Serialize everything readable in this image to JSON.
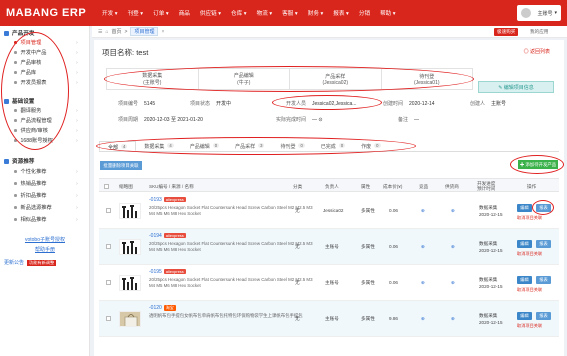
{
  "app": {
    "logo": "MABANG ERP",
    "user": "主账号"
  },
  "nav": [
    "开发 ▾",
    "刊登 ▾",
    "订单 ▾",
    "商品",
    "供应链 ▾",
    "仓库 ▾",
    "物流 ▾",
    "客服 ▾",
    "财务 ▾",
    "报表 ▾",
    "分销",
    "帮助 ▾"
  ],
  "sidebar": {
    "groups": [
      {
        "label": "产品开发",
        "items": [
          "项目管理",
          "开发中产品",
          "产品审核",
          "产品库",
          "开发员报表"
        ]
      },
      {
        "label": "基础设置",
        "items": [
          "翻译服务",
          "产品流程管理",
          "供应商/审核",
          "1688账号授权"
        ]
      },
      {
        "label": "资源推荐",
        "items": [
          "个性化推荐",
          "热销品推荐",
          "折扣品推荐",
          "新品选源推荐",
          "相似品推荐"
        ]
      }
    ],
    "links": [
      "votobo子账号授权",
      "帮助手册"
    ],
    "notice": "更新公告",
    "notice_badge": "功能有新调整"
  },
  "breadcrumb": {
    "home": "首页",
    "sep": ">",
    "current": "项目管理"
  },
  "top_buttons": {
    "red": "极速购买",
    "link": "我的应用"
  },
  "project": {
    "title_label": "项目名称:",
    "title": "test",
    "back": "◎ 返回列表",
    "steps": [
      {
        "name": "数据采集",
        "sub": "(主账号)"
      },
      {
        "name": "产品编辑",
        "sub": "(牛子)"
      },
      {
        "name": "产品采样",
        "sub": "(Jessica02)"
      },
      {
        "name": "待刊登",
        "sub": "(Jessica01)"
      }
    ],
    "edit_button": "✎ 编辑项目信息",
    "info": {
      "code_label": "项目编号",
      "code": "5145",
      "status_label": "项目状态",
      "status": "开发中",
      "dev_label": "开发人员",
      "dev": "Jessica02,Jessica...",
      "created_label": "创建时间",
      "created": "2020-12-14",
      "creator_label": "创建人",
      "creator": "主账号",
      "period_label": "项目周期",
      "period": "2020-12-03 至 2021-01-20",
      "actual_label": "实际完成时间",
      "actual": "— ⊙",
      "note_label": "备注",
      "note": "—"
    }
  },
  "tabs": [
    {
      "label": "全部",
      "count": "4"
    },
    {
      "label": "数据采集",
      "count": "4"
    },
    {
      "label": "产品编辑",
      "count": "0"
    },
    {
      "label": "产品采样",
      "count": "3"
    },
    {
      "label": "待刊登",
      "count": "0"
    },
    {
      "label": "已完成",
      "count": "0"
    },
    {
      "label": "作废",
      "count": "0"
    }
  ],
  "batch_button": "批量删除项目关联",
  "add_button": "✚ 添加待开发产品",
  "columns": [
    "",
    "缩略图",
    "SKU编号 / 来源 / 名称",
    "分类",
    "负责人",
    "属性",
    "成本价(¥)",
    "竞品",
    "供货商",
    "开发进度\n预计时间",
    "操作"
  ],
  "rows": [
    {
      "sku": "-0193",
      "badge": "aliexpress",
      "title": "20/25pcs Hexagon Socket Flat Countersunk Head Screw Carbon Steel M2 M2.5 M3 M4 M5 M6 M8 Hex Socket",
      "category": "无",
      "owner": "Jessica02",
      "attr": "多属性",
      "cost": "0.06",
      "stage": "数据采集",
      "date": "2020-12-15",
      "op1": "编辑",
      "op2": "报表",
      "op3": "取消项目关联"
    },
    {
      "sku": "-0194",
      "badge": "aliexpress",
      "title": "20/25pcs Hexagon Socket Flat Countersunk Head Screw Carbon Steel M2 M2.5 M3 M4 M5 M6 M8 Hex Socket",
      "category": "无",
      "owner": "主账号",
      "attr": "多属性",
      "cost": "0.06",
      "stage": "数据采集",
      "date": "2020-12-15",
      "op1": "编辑",
      "op2": "报表",
      "op3": "取消项目关联"
    },
    {
      "sku": "-0195",
      "badge": "aliexpress",
      "title": "20/25pcs Hexagon Socket Flat Countersunk Head Screw Carbon Steel M2 M2.5 M3 M4 M5 M6 M8 Hex Socket",
      "category": "无",
      "owner": "主账号",
      "attr": "多属性",
      "cost": "0.06",
      "stage": "数据采集",
      "date": "2020-12-15",
      "op1": "编辑",
      "op2": "报表",
      "op3": "取消项目关联"
    },
    {
      "sku": "-0120",
      "badge": "淘宝",
      "title": "透明帆布包手提包女帆布包单肩帆布包托特包环保购物袋学生上课帆布包手提包",
      "category": "无",
      "owner": "主账号",
      "attr": "多属性",
      "cost": "9.86",
      "stage": "数据采集",
      "date": "2020-12-15",
      "op1": "编辑",
      "op2": "报表",
      "op3": "取消项目关联"
    }
  ],
  "colors": {
    "brand": "#d9261c",
    "link": "#2d6fd0",
    "green": "#3bb14a",
    "annotation": "#e02020"
  }
}
